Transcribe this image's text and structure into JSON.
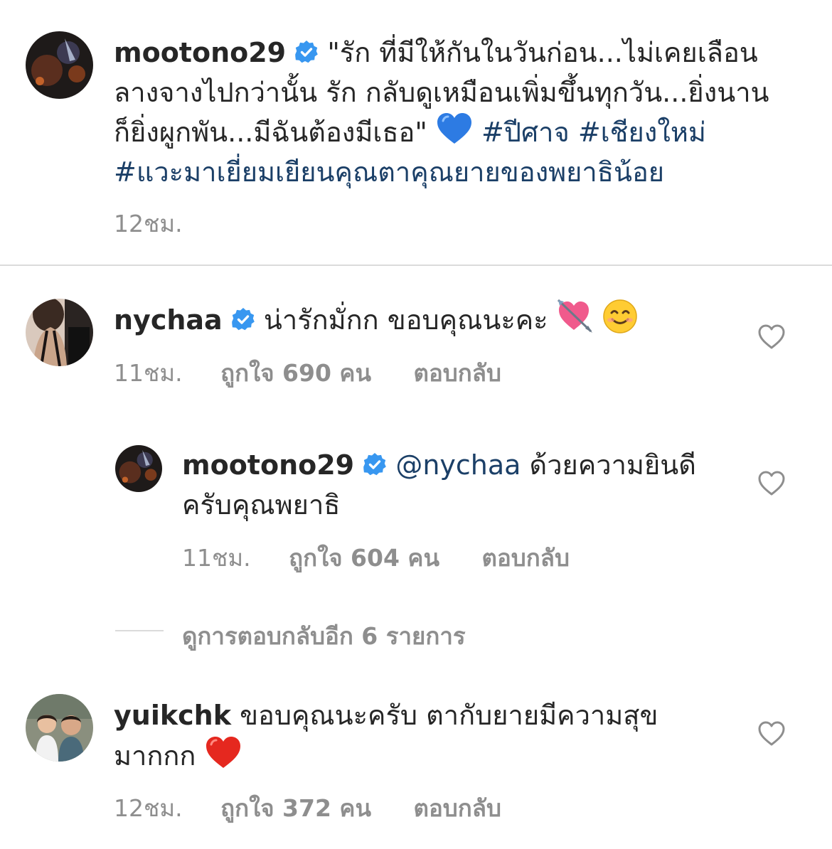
{
  "caption": {
    "username": "mootono29",
    "line1": "\"รัก ที่มีให้กันในวันก่อน...ไม่เคยเลือน",
    "line2": "ลางจางไปกว่านั้น รัก กลับดูเหมือนเพิ่มขึ้นทุกวัน...ยิ่งนาน",
    "line3_text": "ก็ยิ่งผูกพัน...มีฉันต้องมีเธอ\"",
    "line3_emoji": "💙",
    "hashtag1": "#ปีศาจ",
    "hashtag2": "#เชียงใหม่",
    "hashtag3": "#แวะมาเยี่ยมเยียนคุณตาคุณยายของพยาธิน้อย",
    "time": "12ชม."
  },
  "comments": [
    {
      "username": "nychaa",
      "text": "น่ารักมั่กก ขอบคุณนะคะ",
      "emoji1": "💘",
      "emoji2": "😊",
      "time": "11ชม.",
      "likes": "ถูกใจ 690 คน",
      "reply": "ตอบกลับ"
    },
    {
      "username": "mootono29",
      "mention": "@nychaa",
      "text_line1": "ด้วยความยินดี",
      "text_line2": "ครับคุณพยาธิ",
      "time": "11ชม.",
      "likes": "ถูกใจ 604 คน",
      "reply": "ตอบกลับ"
    },
    {
      "username": "yuikchk",
      "text_line1": "ขอบคุณนะครับ ตากับยายมีความสุข",
      "text_line2": "มากกก",
      "emoji": "❤️",
      "time": "12ชม.",
      "likes": "ถูกใจ 372 คน",
      "reply": "ตอบกลับ"
    }
  ],
  "view_replies": "ดูการตอบกลับอีก 6 รายการ",
  "colors": {
    "text": "#262626",
    "secondary": "#8e8e8e",
    "link": "#1b3f67",
    "verified": "#3897f0",
    "divider": "#dbdbdb"
  },
  "icons": [
    "verified-badge-icon",
    "heart-outline-icon",
    "blue-heart-emoji",
    "heart-arrow-emoji",
    "smiling-face-emoji",
    "red-heart-emoji"
  ]
}
